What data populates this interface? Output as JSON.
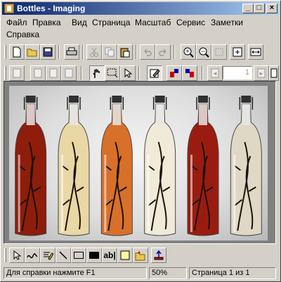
{
  "window": {
    "title": "Bottles - Imaging"
  },
  "titlebar": {
    "minimize_glyph": "_",
    "maximize_glyph": "□",
    "close_glyph": "×"
  },
  "menu": {
    "items": [
      "Файл",
      "Правка",
      "Вид",
      "Страница",
      "Масштаб",
      "Сервис",
      "Заметки",
      "Справка"
    ]
  },
  "toolbar": {
    "zoom_in_glyph": "+",
    "zoom_out_glyph": "−"
  },
  "page_nav": {
    "page_value": "1",
    "prev_glyph": "◄",
    "next_glyph": "►"
  },
  "annotation_tools": {
    "text_tool_label": "ab|"
  },
  "photo": {
    "description_icon": "six-bottles-photo",
    "bottle_count": 6,
    "bottle_colors": [
      "#8e1d0c",
      "#e9d7a6",
      "#d8702a",
      "#f0ead8",
      "#9a1c10",
      "#ded8c4"
    ]
  },
  "status": {
    "help_text": "Для справки нажмите F1",
    "zoom": "50%",
    "page_info": "Страница 1 из 1"
  },
  "colors": {
    "titlebar_start": "#0a246a",
    "titlebar_end": "#a6caf0",
    "chrome": "#d4d0c8"
  }
}
